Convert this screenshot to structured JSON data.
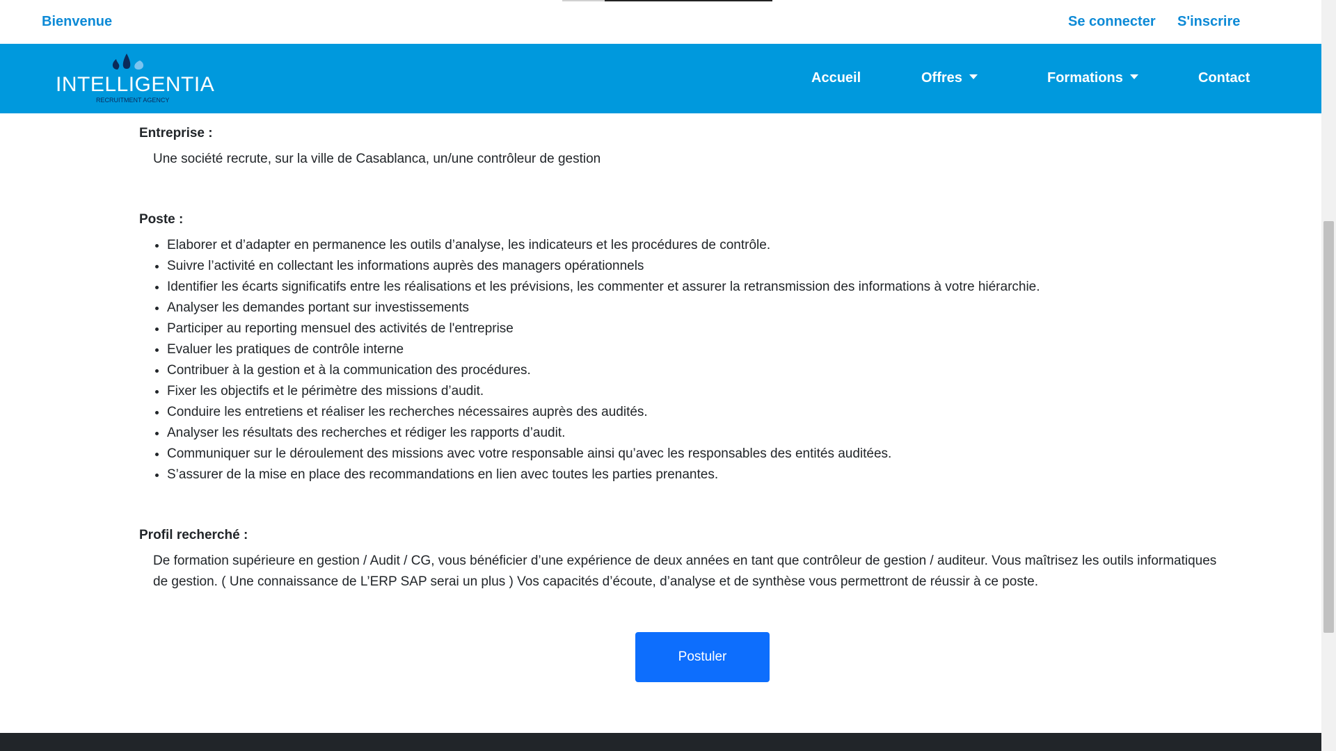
{
  "topbar": {
    "welcome": "Bienvenue",
    "login": "Se connecter",
    "signup": "S'inscrire"
  },
  "brand": {
    "name": "INTELLIGENTIA",
    "tagline": "RECRUITMENT AGENCY",
    "color": "#0099dd"
  },
  "nav": {
    "accueil": "Accueil",
    "offres": "Offres",
    "formations": "Formations",
    "contact": "Contact"
  },
  "job": {
    "entreprise_title": "Entreprise :",
    "entreprise_text": "Une société recrute, sur la ville de Casablanca, un/une contrôleur de gestion",
    "poste_title": "Poste :",
    "poste_items": [
      "Elaborer et d’adapter en permanence les outils d’analyse, les indicateurs et les procédures de contrôle.",
      "Suivre l’activité en collectant les informations auprès des managers opérationnels",
      "Identifier les écarts significatifs entre les réalisations et les prévisions, les commenter et assurer la retransmission des informations à votre hiérarchie.",
      "Analyser les demandes portant sur investissements",
      "Participer au reporting mensuel des activités de l'entreprise",
      "Evaluer les pratiques de contrôle interne",
      "Contribuer à la gestion et à la communication des procédures.",
      "Fixer les objectifs et le périmètre des missions d’audit.",
      "Conduire les entretiens et réaliser les recherches nécessaires auprès des audités.",
      "Analyser les résultats des recherches et rédiger les rapports d’audit.",
      "Communiquer sur le déroulement des missions avec votre responsable ainsi qu’avec les responsables des entités auditées.",
      "S’assurer de la mise en place des recommandations en lien avec toutes les parties prenantes."
    ],
    "profil_title": "Profil recherché :",
    "profil_text": "De formation supérieure en gestion / Audit / CG, vous bénéficier d’une expérience de deux années en tant que contrôleur de gestion / auditeur. Vous maîtrisez les outils informatiques de gestion. ( Une connaissance de L’ERP SAP serai un plus ) Vos capacités d’écoute, d’analyse et de synthèse vous permettront de réussir à ce poste."
  },
  "apply_button": "Postuler"
}
